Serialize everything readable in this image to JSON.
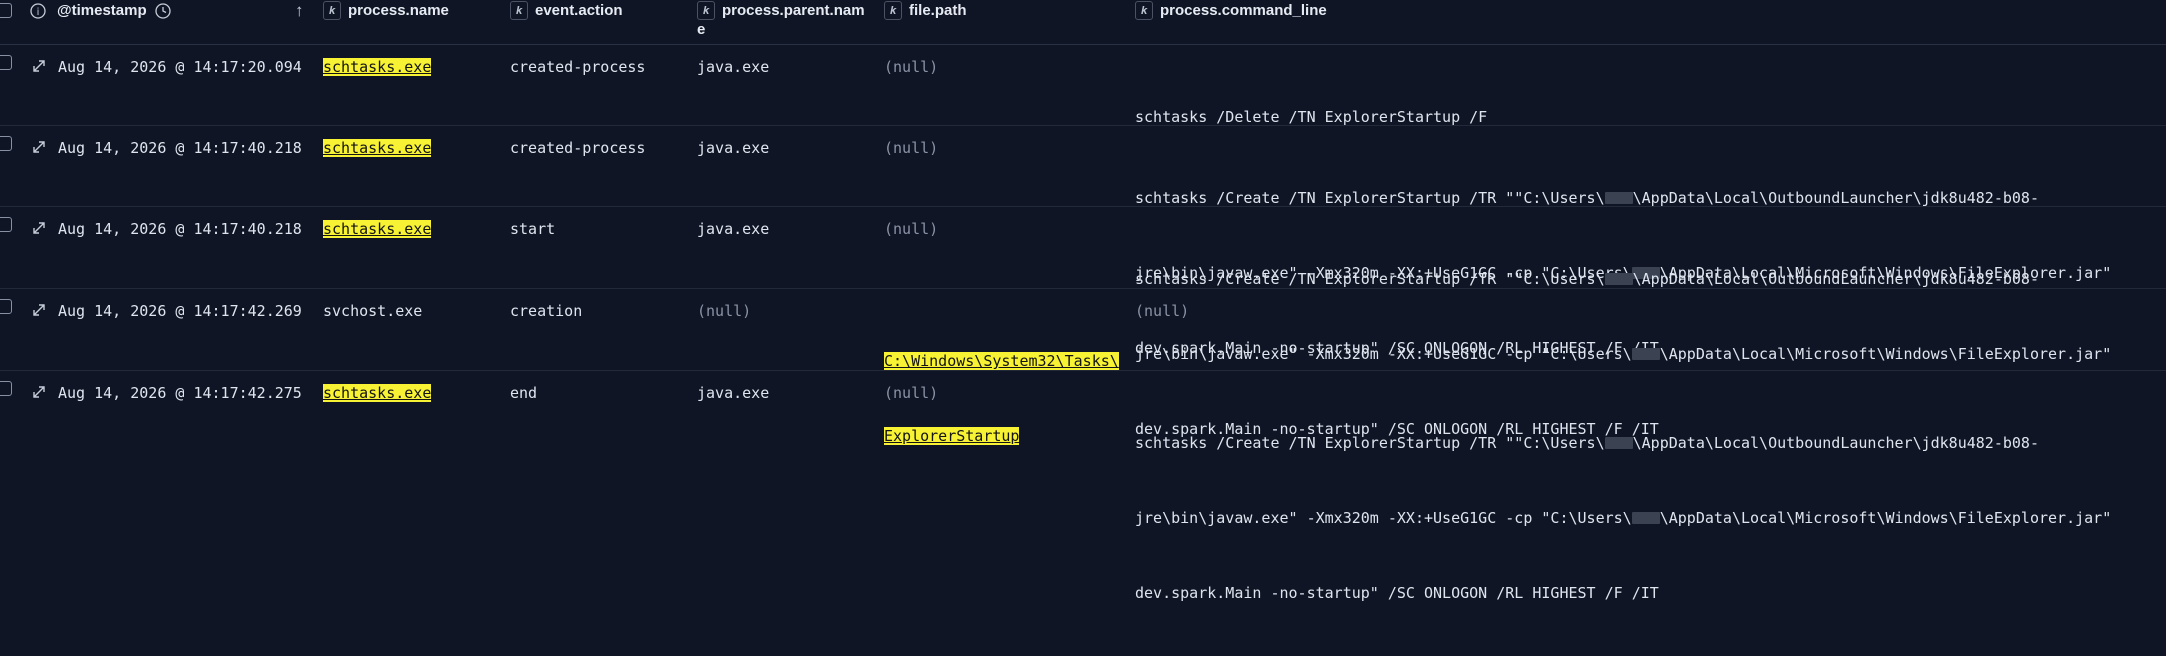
{
  "columns": {
    "info_label": "i",
    "timestamp": "@timestamp",
    "sort_arrow": "↑",
    "k_badge": "k",
    "process_name": "process.name",
    "event_action": "event.action",
    "process_parent_name_line1": "process.parent.nam",
    "process_parent_name_line2": "e",
    "file_path": "file.path",
    "process_command_line": "process.command_line"
  },
  "rows": [
    {
      "timestamp": "Aug 14, 2026 @ 14:17:20.094",
      "process_name": "schtasks.exe",
      "event_action": "created-process",
      "parent_name": "java.exe",
      "file_path": "(null)",
      "cmd": [
        "schtasks /Delete /TN ExplorerStartup /F"
      ]
    },
    {
      "timestamp": "Aug 14, 2026 @ 14:17:40.218",
      "process_name": "schtasks.exe",
      "event_action": "created-process",
      "parent_name": "java.exe",
      "file_path": "(null)",
      "cmd": [
        "schtasks /Create /TN ExplorerStartup /TR \"\"C:\\Users\\",
        "\\AppData\\Local\\OutboundLauncher\\jdk8u482-b08-",
        "jre\\bin\\javaw.exe\" -Xmx320m -XX:+UseG1GC -cp \"C:\\Users\\",
        "\\AppData\\Local\\Microsoft\\Windows\\FileExplorer.jar\"",
        "dev.spark.Main -no-startup\" /SC ONLOGON /RL HIGHEST /F /IT"
      ]
    },
    {
      "timestamp": "Aug 14, 2026 @ 14:17:40.218",
      "process_name": "schtasks.exe",
      "event_action": "start",
      "parent_name": "java.exe",
      "file_path": "(null)",
      "cmd": [
        "schtasks /Create /TN ExplorerStartup /TR \"\"C:\\Users\\",
        "\\AppData\\Local\\OutboundLauncher\\jdk8u482-b08-",
        "jre\\bin\\javaw.exe\" -Xmx320m -XX:+UseG1GC -cp \"C:\\Users\\",
        "\\AppData\\Local\\Microsoft\\Windows\\FileExplorer.jar\"",
        "dev.spark.Main -no-startup\" /SC ONLOGON /RL HIGHEST /F /IT"
      ]
    },
    {
      "timestamp": "Aug 14, 2026 @ 14:17:42.269",
      "process_name": "svchost.exe",
      "event_action": "creation",
      "parent_name": "(null)",
      "file_path_lines": [
        "C:\\Windows\\System32\\Tasks\\",
        "ExplorerStartup"
      ],
      "cmd_null": "(null)"
    },
    {
      "timestamp": "Aug 14, 2026 @ 14:17:42.275",
      "process_name": "schtasks.exe",
      "event_action": "end",
      "parent_name": "java.exe",
      "file_path": "(null)",
      "cmd": [
        "schtasks /Create /TN ExplorerStartup /TR \"\"C:\\Users\\",
        "\\AppData\\Local\\OutboundLauncher\\jdk8u482-b08-",
        "jre\\bin\\javaw.exe\" -Xmx320m -XX:+UseG1GC -cp \"C:\\Users\\",
        "\\AppData\\Local\\Microsoft\\Windows\\FileExplorer.jar\"",
        "dev.spark.Main -no-startup\" /SC ONLOGON /RL HIGHEST /F /IT"
      ]
    }
  ],
  "colors": {
    "background": "#0f1524",
    "highlight": "#f7f234",
    "null_text": "#8a93a6"
  }
}
